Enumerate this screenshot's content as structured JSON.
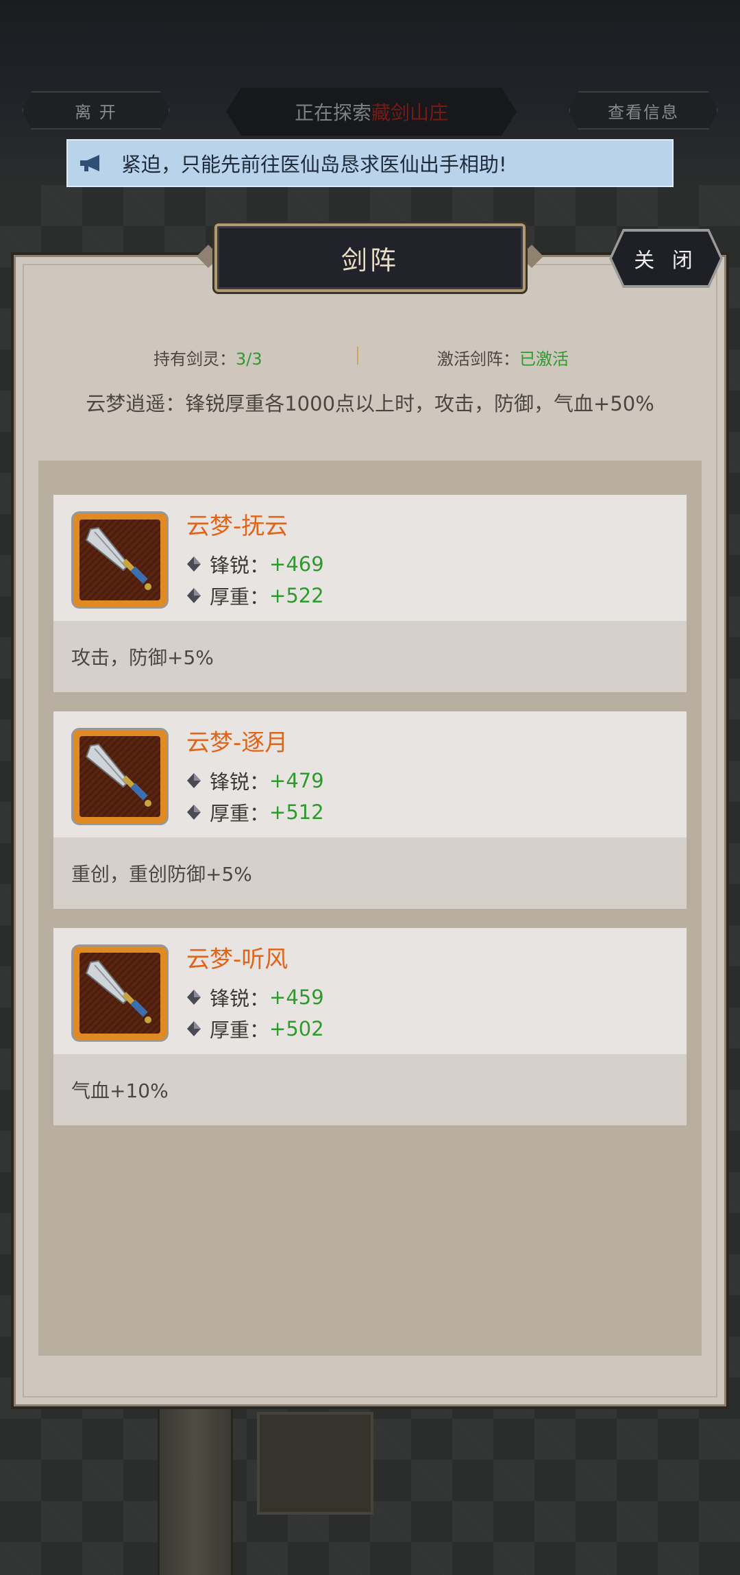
{
  "topbar": {
    "leave_label": "离 开",
    "exploring_prefix": "正在探索",
    "exploring_location": "藏剑山庄",
    "info_label": "查看信息"
  },
  "notice": {
    "icon": "megaphone-icon",
    "text": "紧迫，只能先前往医仙岛恳求医仙出手相助!"
  },
  "dialog": {
    "title": "剑阵",
    "close_label": "关 闭",
    "held_label": "持有剑灵：",
    "held_value": "3/3",
    "active_label": "激活剑阵：",
    "active_value": "已激活",
    "set_effect": "云梦逍遥：锋锐厚重各1000点以上时，攻击，防御，气血+50%"
  },
  "spirits": [
    {
      "name": "云梦-抚云",
      "attr1_label": "锋锐：",
      "attr1_value": "+469",
      "attr2_label": "厚重：",
      "attr2_value": "+522",
      "bonus": "攻击，防御+5%"
    },
    {
      "name": "云梦-逐月",
      "attr1_label": "锋锐：",
      "attr1_value": "+479",
      "attr2_label": "厚重：",
      "attr2_value": "+512",
      "bonus": "重创，重创防御+5%"
    },
    {
      "name": "云梦-听风",
      "attr1_label": "锋锐：",
      "attr1_value": "+459",
      "attr2_label": "厚重：",
      "attr2_value": "+502",
      "bonus": "气血+10%"
    }
  ],
  "colors": {
    "accent_orange": "#e0651b",
    "value_green": "#2e9a2e",
    "location_red": "#7a1a14",
    "notice_bg": "#b9d3ea"
  }
}
